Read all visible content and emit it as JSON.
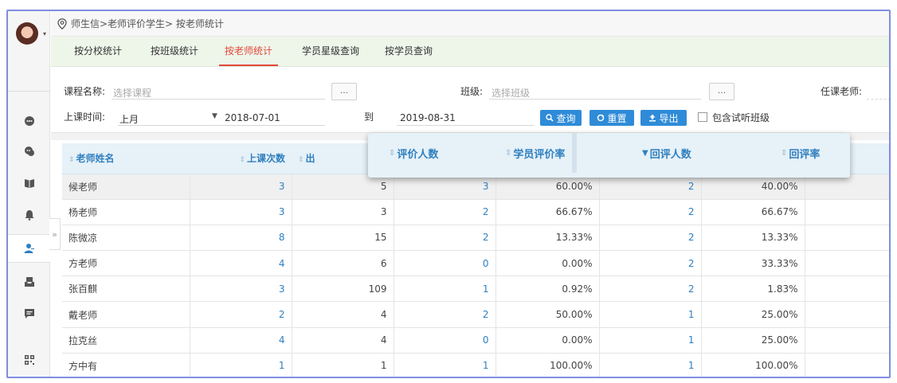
{
  "breadcrumb": "师生信>老师评价学生> 按老师统计",
  "tabs": [
    {
      "label": "按分校统计"
    },
    {
      "label": "按班级统计"
    },
    {
      "label": "按老师统计"
    },
    {
      "label": "学员星级查询"
    },
    {
      "label": "按学员查询"
    }
  ],
  "filters": {
    "course_label": "课程名称:",
    "course_placeholder": "选择课程",
    "class_label": "班级:",
    "class_placeholder": "选择班级",
    "teacher_label": "任课老师:",
    "time_label": "上课时间:",
    "time_range": "上月",
    "start_date": "2018-07-01",
    "to_label": "到",
    "end_date": "2019-08-31",
    "dots": "...",
    "query_btn": "查询",
    "reset_btn": "重置",
    "export_btn": "导出",
    "trial_label": "包含试听班级"
  },
  "table": {
    "headers": [
      "老师姓名",
      "上课次数",
      "出"
    ],
    "rows": [
      [
        "候老师",
        "3",
        "5",
        "3",
        "60.00%",
        "2",
        "40.00%"
      ],
      [
        "杨老师",
        "3",
        "3",
        "2",
        "66.67%",
        "2",
        "66.67%"
      ],
      [
        "陈微凉",
        "8",
        "15",
        "2",
        "13.33%",
        "2",
        "13.33%"
      ],
      [
        "方老师",
        "4",
        "6",
        "0",
        "0.00%",
        "2",
        "33.33%"
      ],
      [
        "张百麒",
        "3",
        "109",
        "1",
        "0.92%",
        "2",
        "1.83%"
      ],
      [
        "戴老师",
        "2",
        "4",
        "2",
        "50.00%",
        "1",
        "25.00%"
      ],
      [
        "拉克丝",
        "4",
        "4",
        "0",
        "0.00%",
        "1",
        "25.00%"
      ],
      [
        "方中有",
        "1",
        "1",
        "1",
        "100.00%",
        "1",
        "100.00%"
      ]
    ]
  },
  "float_headers": [
    "评价人数",
    "学员评价率",
    "回评人数",
    "回评率"
  ],
  "colors": {
    "accent": "#2f8bd8",
    "active_tab": "#e2493b",
    "header_text": "#2f7fbf"
  }
}
